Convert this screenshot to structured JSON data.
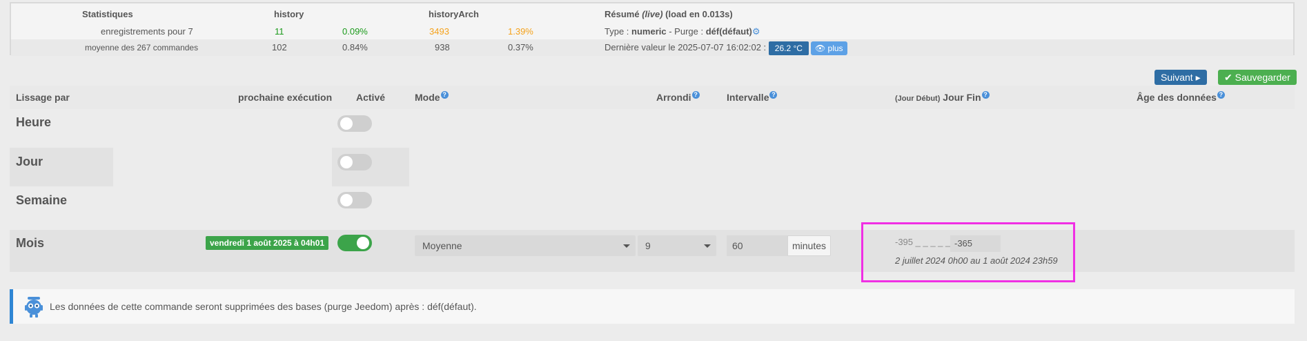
{
  "stats": {
    "headers": {
      "statistiques": "Statistiques",
      "history": "history",
      "historyArch": "historyArch",
      "resume_prefix": "Résumé ",
      "resume_live": "(live)",
      "resume_suffix": " (load en 0.013s)"
    },
    "row1": {
      "label": "enregistrements pour 7",
      "history_count": "11",
      "history_pct": "0.09%",
      "arch_count": "3493",
      "arch_pct": "1.39%",
      "type_label": "Type : ",
      "type_value": "numeric",
      "purge_label": " - Purge : ",
      "purge_value": "déf(défaut)"
    },
    "row2": {
      "label": "moyenne des 267 commandes",
      "history_count": "102",
      "history_pct": "0.84%",
      "arch_count": "938",
      "arch_pct": "0.37%",
      "last_value_label": "Dernière valeur le 2025-07-07 16:02:02 :",
      "temp_badge": "26.2 °C",
      "plus_label": "plus"
    }
  },
  "buttons": {
    "next_label": "Suivant",
    "save_label": "Sauvegarder"
  },
  "table": {
    "headers": {
      "lissage": "Lissage par",
      "prochaine": "prochaine exécution",
      "active": "Activé",
      "mode": "Mode",
      "arrondi": "Arrondi",
      "intervalle": "Intervalle",
      "jour_debut": "(Jour Début)",
      "jour_fin": " Jour Fin",
      "age": "Âge des données"
    },
    "rows": {
      "heure": {
        "label": "Heure",
        "active": false
      },
      "jour": {
        "label": "Jour",
        "active": false
      },
      "semaine": {
        "label": "Semaine",
        "active": false
      },
      "mois": {
        "label": "Mois",
        "active": true,
        "next_run": "vendredi 1 août 2025 à 04h01",
        "mode": "Moyenne",
        "arrondi": "9",
        "intervalle": "60",
        "intervalle_unit": "minutes",
        "jour_debut": "-395",
        "jour_debut_sep": " _ _ _ _ _",
        "jour_fin": "-365",
        "range_text": "2 juillet 2024 0h00 au 1 août 2024 23h59"
      }
    }
  },
  "alert": {
    "text": "Les données de cette commande seront supprimées des bases (purge Jeedom) après : déf(défaut)."
  },
  "colors": {
    "primary": "#2e6da4",
    "success": "#4caf50",
    "toggle_on": "#3ca44a",
    "highlight": "#f02fe4",
    "history_green": "#1a9a1a",
    "arch_orange": "#f5a21b"
  }
}
